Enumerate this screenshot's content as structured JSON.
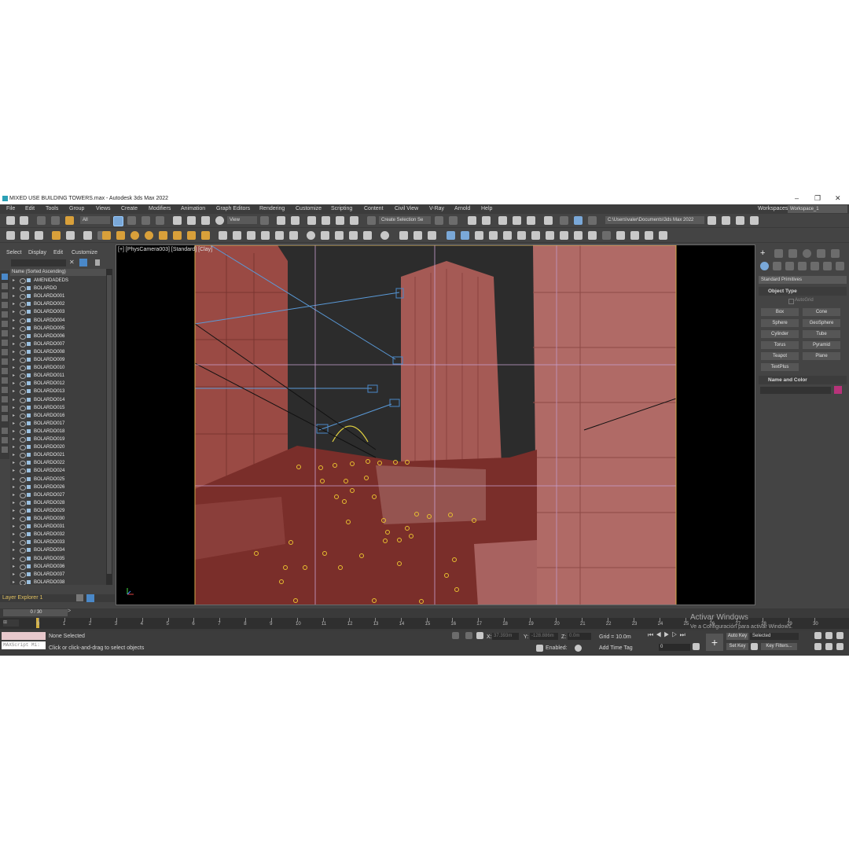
{
  "window": {
    "title": "MIXED USE BUILDING TOWERS.max - Autodesk 3ds Max 2022",
    "controls": [
      "–",
      "❐",
      "✕"
    ]
  },
  "menu": {
    "items": [
      "File",
      "Edit",
      "Tools",
      "Group",
      "Views",
      "Create",
      "Modifiers",
      "Animation",
      "Graph Editors",
      "Rendering",
      "Customize",
      "Scripting",
      "Content",
      "Civil View",
      "V-Ray",
      "Arnold",
      "Help"
    ],
    "workspaces_label": "Workspaces:",
    "workspace_value": "Workspace_1"
  },
  "toolbar": {
    "selection_filter": "All",
    "reference_coord": "View",
    "named_selection_placeholder": "Create Selection Se",
    "project_path": "C:\\Users\\valer\\Documents\\3ds Max 2022"
  },
  "scene_explorer": {
    "menu": [
      "Select",
      "Display",
      "Edit",
      "Customize"
    ],
    "column_header": "Name (Sorted Ascending)",
    "items": [
      "AMENIDADEDS",
      "BOLARDO",
      "BOLARDO001",
      "BOLARDO002",
      "BOLARDO003",
      "BOLARDO004",
      "BOLARDO005",
      "BOLARDO006",
      "BOLARDO007",
      "BOLARDO008",
      "BOLARDO009",
      "BOLARDO010",
      "BOLARDO011",
      "BOLARDO012",
      "BOLARDO013",
      "BOLARDO014",
      "BOLARDO015",
      "BOLARDO016",
      "BOLARDO017",
      "BOLARDO018",
      "BOLARDO019",
      "BOLARDO020",
      "BOLARDO021",
      "BOLARDO022",
      "BOLARDO024",
      "BOLARDO025",
      "BOLARDO026",
      "BOLARDO027",
      "BOLARDO028",
      "BOLARDO029",
      "BOLARDO030",
      "BOLARDO031",
      "BOLARDO032",
      "BOLARDO033",
      "BOLARDO034",
      "BOLARDO035",
      "BOLARDO036",
      "BOLARDO037",
      "BOLARDO038"
    ],
    "layer_explorer": "Layer Explorer 1",
    "frame_counter": "0 / 30"
  },
  "viewport": {
    "label": "[+] [PhysCamera003] [Standard] [Clay]"
  },
  "command_panel": {
    "category": "Standard Primitives",
    "object_type_title": "Object Type",
    "autogrid": "AutoGrid",
    "buttons": [
      "Box",
      "Cone",
      "Sphere",
      "GeoSphere",
      "Cylinder",
      "Tube",
      "Torus",
      "Pyramid",
      "Teapot",
      "Plane",
      "TextPlus"
    ],
    "name_color_title": "Name and Color",
    "object_color": "#b8337a"
  },
  "timeline": {
    "ticks": [
      "0",
      "1",
      "2",
      "3",
      "4",
      "5",
      "6",
      "7",
      "8",
      "9",
      "10",
      "11",
      "12",
      "13",
      "14",
      "15",
      "16",
      "17",
      "18",
      "19",
      "20",
      "21",
      "22",
      "23",
      "24",
      "25",
      "26",
      "27",
      "28",
      "29",
      "30"
    ]
  },
  "status": {
    "maxscript": "MAXScript Mi:",
    "selection": "None Selected",
    "prompt": "Click or click-and-drag to select objects",
    "x_label": "X:",
    "x_value": "37.393m",
    "y_label": "Y:",
    "y_value": "-128.886m",
    "z_label": "Z:",
    "z_value": "0.0m",
    "grid": "Grid = 10.0m",
    "enabled": "Enabled:",
    "add_time_tag": "Add Time Tag",
    "auto_key": "Auto Key",
    "set_key": "Set Key",
    "key_mode": "Selected",
    "key_filters": "Key Filters...",
    "current_frame": "0",
    "watermark_title": "Activar Windows",
    "watermark_sub": "Ve a Configuración para activar Windows."
  }
}
